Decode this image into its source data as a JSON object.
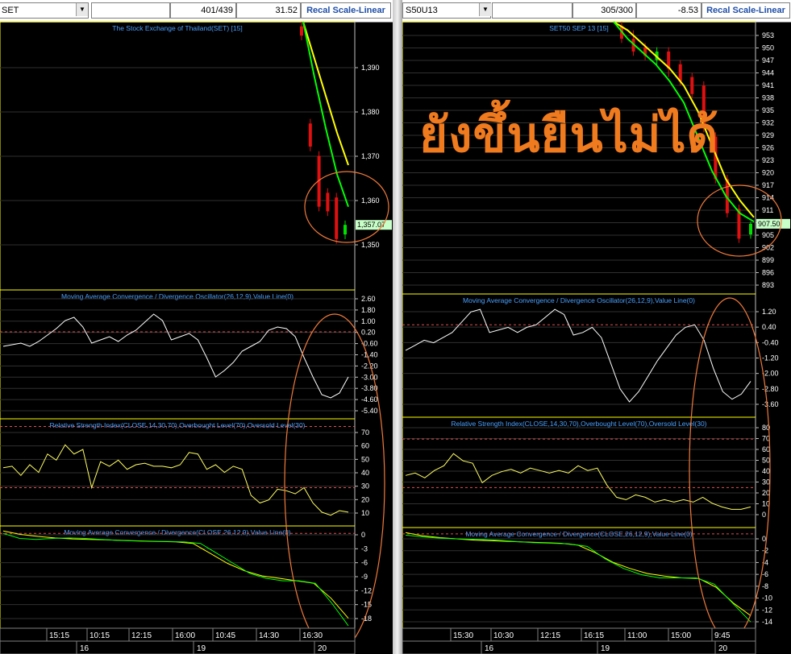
{
  "overlay_text": "ยังขึ้นยืนไม่ได้",
  "left": {
    "symbol": "SET",
    "count": "401/439",
    "change": "31.52",
    "recal_label": "Recal Scale-Linear",
    "price_title": "The Stock Exchange of Thailand(SET) [15]",
    "price_label": "1,357.07",
    "macd_title": "Moving Average Convergence / Divergence Oscillator(26,12,9),Value Line(0)",
    "rsi_title": "Relative Strength Index(CLOSE,14,30,70),Overbought Level(70),Oversold Level(30)",
    "macd2_title": "Moving Average Convergence / Divergence(CLOSE,26,12,9),Value Line(0)",
    "price_ticks": [
      "1,390",
      "1,380",
      "1,370",
      "1,360",
      "1,350"
    ],
    "macd_ticks": [
      "2.60",
      "1.80",
      "1.00",
      "0.20",
      "-0.60",
      "-1.40",
      "-2.20",
      "-3.00",
      "-3.80",
      "-4.60",
      "-5.40"
    ],
    "rsi_ticks": [
      "70",
      "60",
      "50",
      "40",
      "30",
      "20",
      "10"
    ],
    "macd2_ticks": [
      "0",
      "-3",
      "-6",
      "-9",
      "-12",
      "-15",
      "-18"
    ],
    "time_labels": [
      "15:15",
      "10:15",
      "12:15",
      "16:00",
      "10:45",
      "14:30",
      "16:30"
    ],
    "day_labels": [
      "16",
      "19",
      "20"
    ]
  },
  "right": {
    "symbol": "S50U13",
    "count": "305/300",
    "change": "-8.53",
    "recal_label": "Recal Scale-Linear",
    "price_title": "SET50 SEP 13  [15]",
    "price_label": "907.50",
    "macd_title": "Moving Average Convergence / Divergence Oscillator(26,12,9),Value Line(0)",
    "rsi_title": "Relative Strength Index(CLOSE,14,30,70),Overbought Level(70),Oversold Level(30)",
    "macd2_title": "Moving Average Convergence / Divergence(CLOSE,26,12,9),Value Line(0)",
    "price_ticks": [
      "953",
      "950",
      "947",
      "944",
      "941",
      "938",
      "935",
      "932",
      "929",
      "926",
      "923",
      "920",
      "917",
      "914",
      "911",
      "908",
      "905",
      "902",
      "899",
      "896",
      "893"
    ],
    "macd_ticks": [
      "1.20",
      "0.40",
      "-0.40",
      "-1.20",
      "-2.00",
      "-2.80",
      "-3.60"
    ],
    "rsi_ticks": [
      "80",
      "70",
      "60",
      "50",
      "40",
      "30",
      "20",
      "10",
      "0"
    ],
    "macd2_ticks": [
      "0",
      "-2",
      "-4",
      "-6",
      "-8",
      "-10",
      "-12",
      "-14"
    ],
    "time_labels": [
      "15:30",
      "10:30",
      "12:15",
      "16:15",
      "11:00",
      "15:00",
      "9:45"
    ],
    "day_labels": [
      "16",
      "19",
      "20"
    ]
  },
  "chart_data": [
    {
      "type": "line",
      "title": "The Stock Exchange of Thailand(SET) [15]",
      "panel": "price",
      "ylim": [
        1343,
        1401
      ],
      "candles": [
        {
          "o": 1400,
          "c": 1398,
          "h": 1401,
          "l": 1397
        },
        {
          "o": 1379,
          "c": 1374,
          "h": 1380,
          "l": 1373
        },
        {
          "o": 1372,
          "c": 1361,
          "h": 1373,
          "l": 1360
        },
        {
          "o": 1364,
          "c": 1360,
          "h": 1365,
          "l": 1359
        },
        {
          "o": 1363,
          "c": 1354,
          "h": 1364,
          "l": 1353
        },
        {
          "o": 1355,
          "c": 1357.07,
          "h": 1358,
          "l": 1354
        }
      ],
      "series": [
        {
          "name": "",
          "color": "#ffff00",
          "values": [
            1401,
            1393,
            1385,
            1377,
            1370
          ]
        },
        {
          "name": "",
          "color": "#00ff00",
          "values": [
            1401,
            1389,
            1378,
            1368,
            1361
          ]
        }
      ],
      "last": 1357.07
    },
    {
      "type": "line",
      "title": "Moving Average Convergence / Divergence Oscillator(26,12,9),Value Line(0)",
      "ylim": [
        -5.4,
        2.6
      ],
      "values": [
        -0.9,
        -0.8,
        -0.7,
        -0.9,
        -0.6,
        -0.2,
        0.2,
        0.7,
        0.9,
        0.3,
        -0.7,
        -0.5,
        -0.3,
        -0.6,
        -0.2,
        0.1,
        0.6,
        1.1,
        0.7,
        -0.5,
        -0.3,
        -0.1,
        -0.5,
        -1.6,
        -2.8,
        -2.4,
        -1.9,
        -1.2,
        -0.9,
        -0.6,
        0.1,
        0.3,
        0.2,
        -0.3,
        -1.6,
        -2.8,
        -3.9,
        -4.1,
        -3.8,
        -2.8
      ]
    },
    {
      "type": "line",
      "title": "Relative Strength Index(CLOSE,14,30,70),Overbought Level(70),Oversold Level(30)",
      "ylim": [
        5,
        75
      ],
      "values": [
        43,
        44,
        38,
        45,
        40,
        52,
        48,
        58,
        52,
        55,
        30,
        47,
        44,
        48,
        42,
        45,
        46,
        44,
        44,
        43,
        45,
        53,
        52,
        42,
        45,
        40,
        44,
        42,
        25,
        20,
        22,
        29,
        28,
        26,
        30,
        20,
        14,
        12,
        15,
        14
      ]
    },
    {
      "type": "line",
      "title": "Moving Average Convergence / Divergence(CLOSE,26,12,9),Value Line(0)",
      "ylim": [
        -19,
        1.5
      ],
      "series": [
        {
          "name": "",
          "color": "#ffff00",
          "values": [
            0.5,
            -0.2,
            -0.6,
            -0.9,
            -1.1,
            -1.2,
            -1.3,
            -1.4,
            -1.5,
            -1.6,
            -1.7,
            -2,
            -4,
            -6,
            -7.5,
            -8.5,
            -9,
            -9.5,
            -10,
            -13,
            -17
          ]
        },
        {
          "name": "",
          "color": "#00ff00",
          "values": [
            0,
            -1,
            -1.2,
            -1.0,
            -0.9,
            -1.0,
            -1.2,
            -1.4,
            -1.5,
            -1.6,
            -1.6,
            -1.7,
            -2,
            -4,
            -6,
            -8,
            -9,
            -9.5,
            -9.5,
            -10,
            -14,
            -18.5
          ]
        }
      ]
    },
    {
      "type": "line",
      "title": "SET50 SEP 13  [15]",
      "panel": "price",
      "ylim": [
        891,
        955
      ],
      "candles": [
        {
          "o": 954,
          "c": 951,
          "h": 955,
          "l": 950
        },
        {
          "o": 951,
          "c": 948,
          "h": 953,
          "l": 947
        },
        {
          "o": 949,
          "c": 947,
          "h": 950,
          "l": 946
        },
        {
          "o": 946,
          "c": 948,
          "h": 949,
          "l": 945
        },
        {
          "o": 948,
          "c": 944,
          "h": 949,
          "l": 942
        },
        {
          "o": 945,
          "c": 941,
          "h": 946,
          "l": 940
        },
        {
          "o": 942,
          "c": 938,
          "h": 943,
          "l": 937
        },
        {
          "o": 940,
          "c": 930,
          "h": 941,
          "l": 929
        },
        {
          "o": 928,
          "c": 918,
          "h": 929,
          "l": 917
        },
        {
          "o": 918,
          "c": 910,
          "h": 919,
          "l": 909
        },
        {
          "o": 911,
          "c": 904,
          "h": 912,
          "l": 903
        },
        {
          "o": 905,
          "c": 907.5,
          "h": 908,
          "l": 904
        }
      ],
      "series": [
        {
          "name": "",
          "color": "#ffff00",
          "values": [
            955,
            953,
            950,
            947,
            944,
            940,
            934,
            926,
            918,
            913,
            909
          ]
        },
        {
          "name": "",
          "color": "#00ff00",
          "values": [
            955,
            951,
            948,
            945,
            941,
            936,
            928,
            920,
            914,
            910,
            908
          ]
        }
      ],
      "last": 907.5
    },
    {
      "type": "line",
      "title": "Moving Average Convergence / Divergence Oscillator(26,12,9),Value Line(0)",
      "ylim": [
        -3.6,
        1.2
      ],
      "values": [
        -1.0,
        -0.8,
        -0.6,
        -0.7,
        -0.5,
        -0.3,
        0.1,
        0.5,
        0.6,
        -0.3,
        -0.2,
        -0.1,
        -0.3,
        -0.1,
        0.0,
        0.3,
        0.6,
        0.4,
        -0.4,
        -0.3,
        -0.1,
        -0.5,
        -1.5,
        -2.5,
        -3.0,
        -2.6,
        -2.0,
        -1.4,
        -0.9,
        -0.4,
        -0.1,
        0.0,
        -0.6,
        -1.7,
        -2.6,
        -2.9,
        -2.7,
        -2.2
      ]
    },
    {
      "type": "line",
      "title": "Relative Strength Index(CLOSE,14,30,70),Overbought Level(70),Oversold Level(30)",
      "ylim": [
        -3,
        88
      ],
      "values": [
        40,
        42,
        38,
        44,
        48,
        58,
        52,
        50,
        34,
        40,
        43,
        45,
        42,
        46,
        44,
        42,
        44,
        42,
        48,
        44,
        46,
        32,
        22,
        20,
        24,
        22,
        18,
        20,
        18,
        20,
        18,
        22,
        17,
        14,
        12,
        12,
        14
      ]
    },
    {
      "type": "line",
      "title": "Moving Average Convergence / Divergence(CLOSE,26,12,9),Value Line(0)",
      "ylim": [
        -15,
        1
      ],
      "series": [
        {
          "name": "",
          "color": "#ffff00",
          "values": [
            0.2,
            -0.3,
            -0.6,
            -0.8,
            -1.0,
            -1.1,
            -1.2,
            -1.3,
            -1.4,
            -1.5,
            -1.8,
            -3,
            -4.5,
            -5.5,
            -6.3,
            -6.7,
            -7,
            -7.1,
            -8.5,
            -11,
            -13
          ]
        },
        {
          "name": "",
          "color": "#00ff00",
          "values": [
            -0.2,
            -0.5,
            -0.7,
            -0.8,
            -0.9,
            -1.0,
            -1.2,
            -1.4,
            -1.5,
            -1.6,
            -2,
            -4,
            -5.5,
            -6.5,
            -7,
            -7,
            -7,
            -8,
            -11,
            -14
          ]
        }
      ]
    }
  ]
}
